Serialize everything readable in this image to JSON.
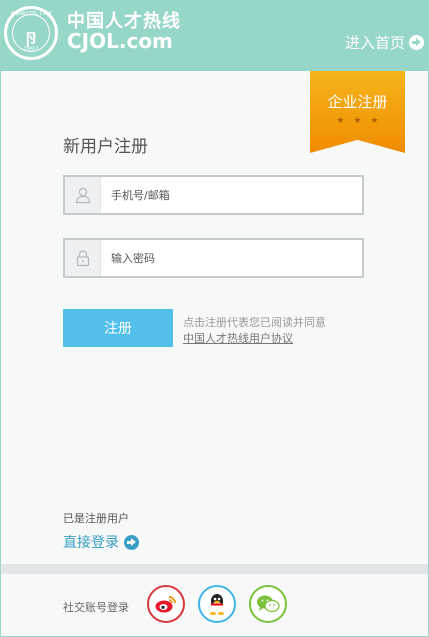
{
  "header": {
    "brand_cn": "中国人才热线",
    "brand_en": "CJOL.com",
    "seal_arc": "WWW.CJOL.COM",
    "seal_letter": "卪",
    "seal_year": "1997",
    "home_link": "进入首页"
  },
  "corp_register": {
    "label": "企业注册",
    "stars": "★★★"
  },
  "form": {
    "title": "新用户注册",
    "account_placeholder": "手机号/邮箱",
    "password_placeholder": "输入密码",
    "submit_label": "注册",
    "agree_text": "点击注册代表您已阅读并同意",
    "agreement_link": "中国人才热线用户协议"
  },
  "login": {
    "prompt": "已是注册用户",
    "link": "直接登录"
  },
  "social": {
    "label": "社交账号登录",
    "providers": [
      "weibo",
      "qq",
      "wechat"
    ]
  },
  "colors": {
    "header": "#97d7ca",
    "button": "#52c0ea",
    "ribbon": "#f5a512",
    "link": "#3a9fc6"
  }
}
